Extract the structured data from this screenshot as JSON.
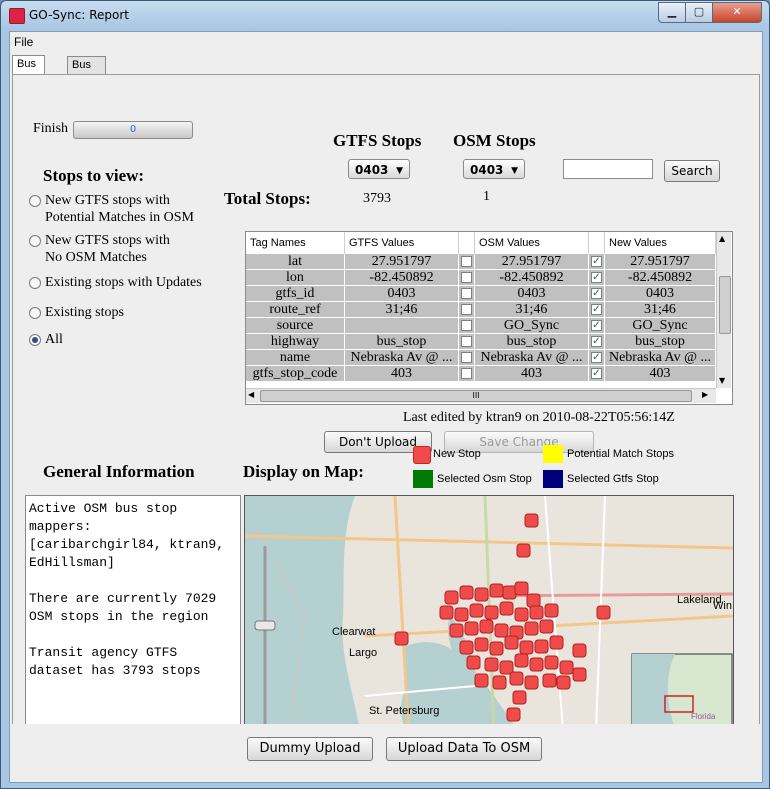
{
  "window": {
    "title": "GO-Sync: Report",
    "min_label": "▁",
    "max_label": "▢",
    "close_label": "✕"
  },
  "menu": {
    "file": "File"
  },
  "tabs": [
    {
      "label": "Bus Stop"
    },
    {
      "label": "Bus Route"
    }
  ],
  "finish": {
    "label": "Finish",
    "value": "0",
    "progress": 0
  },
  "stops_to_view": {
    "title": "Stops to view:",
    "options": [
      {
        "label": "New GTFS stops with\nPotential Matches in OSM",
        "selected": false
      },
      {
        "label": "New GTFS stops with\nNo OSM Matches",
        "selected": false
      },
      {
        "label": "Existing stops with Updates",
        "selected": false
      },
      {
        "label": "Existing stops",
        "selected": false
      },
      {
        "label": "All",
        "selected": true
      }
    ]
  },
  "gtfs": {
    "title": "GTFS Stops",
    "selected": "0403",
    "total": "3793"
  },
  "osm": {
    "title": "OSM Stops",
    "selected": "0403",
    "total": "1"
  },
  "total_label": "Total Stops:",
  "search": {
    "value": "",
    "button": "Search"
  },
  "table": {
    "headers": [
      "Tag Names",
      "GTFS Values",
      "OSM Values",
      "New Values"
    ],
    "rows": [
      {
        "tag": "lat",
        "gtfs": "27.951797",
        "osm": "27.951797",
        "new": "27.951797",
        "osm_checked": false,
        "new_checked": true
      },
      {
        "tag": "lon",
        "gtfs": "-82.450892",
        "osm": "-82.450892",
        "new": "-82.450892",
        "osm_checked": false,
        "new_checked": true
      },
      {
        "tag": "gtfs_id",
        "gtfs": "0403",
        "osm": "0403",
        "new": "0403",
        "osm_checked": false,
        "new_checked": true
      },
      {
        "tag": "route_ref",
        "gtfs": "31;46",
        "osm": "31;46",
        "new": "31;46",
        "osm_checked": false,
        "new_checked": true
      },
      {
        "tag": "source",
        "gtfs": "",
        "osm": "GO_Sync",
        "new": "GO_Sync",
        "osm_checked": false,
        "new_checked": true
      },
      {
        "tag": "highway",
        "gtfs": "bus_stop",
        "osm": "bus_stop",
        "new": "bus_stop",
        "osm_checked": false,
        "new_checked": true
      },
      {
        "tag": "name",
        "gtfs": "Nebraska Av @ ...",
        "osm": "Nebraska Av @ ...",
        "new": "Nebraska Av @ ...",
        "osm_checked": false,
        "new_checked": true
      },
      {
        "tag": "gtfs_stop_code",
        "gtfs": "403",
        "osm": "403",
        "new": "403",
        "osm_checked": false,
        "new_checked": true
      }
    ],
    "hscroll_grip": "III"
  },
  "last_edited": "Last edited by ktran9 on 2010-08-22T05:56:14Z",
  "buttons": {
    "dont_upload": "Don't Upload",
    "save_change": "Save Change",
    "dummy_upload": "Dummy Upload",
    "upload_osm": "Upload Data To OSM"
  },
  "legend": [
    {
      "label": "New Stop",
      "color": "#ef4b4b"
    },
    {
      "label": "Potential Match Stops",
      "color": "#ffff00"
    },
    {
      "label": "Selected Osm Stop",
      "color": "#007a00"
    },
    {
      "label": "Selected Gtfs Stop",
      "color": "#00007a"
    }
  ],
  "general_info": {
    "title": "General Information",
    "text": "Active OSM bus stop\nmappers:\n[caribarchgirl84, ktran9,\nEdHillsman]\n\nThere are currently 7029\nOSM stops in the region\n\nTransit agency GTFS\ndataset has 3793 stops"
  },
  "map": {
    "title": "Display on Map:",
    "places": [
      "Lakeland",
      "Win",
      "Clearwat",
      "Largo",
      "St. Petersburg",
      "Florida"
    ],
    "zoom_out": "−",
    "zoom_in": "+"
  }
}
